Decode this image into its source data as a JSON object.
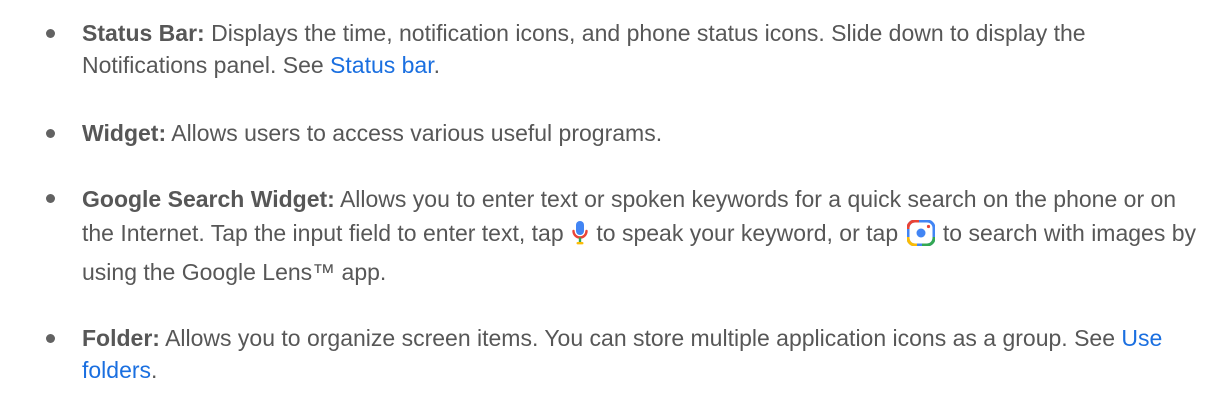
{
  "items": [
    {
      "term": "Status Bar:",
      "text1": " Displays the time, notification icons, and phone status icons. Slide down to display the Notifications panel. See ",
      "link": "Status bar",
      "text2": "."
    },
    {
      "term": "Widget:",
      "text1": " Allows users to access various useful programs."
    },
    {
      "term": "Google Search Widget:",
      "text1": " Allows you to enter text or spoken keywords for a quick search on the phone or on the Internet. Tap the input field to enter text,  tap ",
      "text2": " to speak your keyword, or tap ",
      "text3": " to search with images by using the Google Lens™ app.",
      "icons": [
        "microphone-icon",
        "google-lens-icon"
      ]
    },
    {
      "term": "Folder:",
      "text1": " Allows you to organize screen items. You can store multiple application icons as a group. See ",
      "link": "Use folders",
      "text2": "."
    }
  ],
  "colors": {
    "text": "#575757",
    "link": "#1a6fe0",
    "bullet": "#626262"
  }
}
